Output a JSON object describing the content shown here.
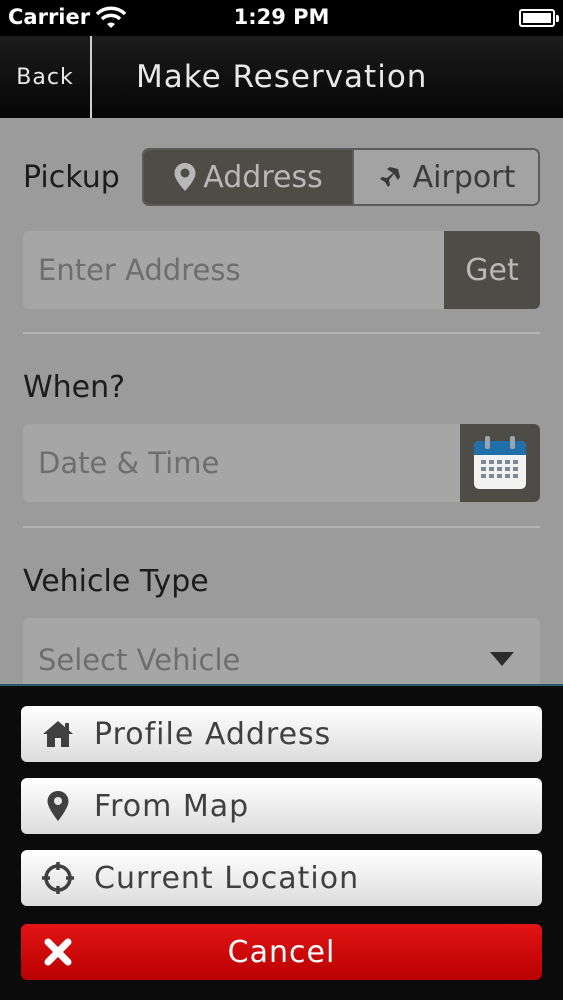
{
  "status_bar": {
    "carrier": "Carrier",
    "time": "1:29 PM"
  },
  "nav": {
    "back_label": "Back",
    "title": "Make Reservation"
  },
  "pickup": {
    "label": "Pickup",
    "segments": [
      {
        "label": "Address",
        "icon": "map-pin-icon",
        "selected": true
      },
      {
        "label": "Airport",
        "icon": "airplane-icon",
        "selected": false
      }
    ],
    "address_placeholder": "Enter Address",
    "get_label": "Get"
  },
  "when": {
    "label": "When?",
    "placeholder": "Date & Time",
    "icon": "calendar-icon"
  },
  "vehicle": {
    "label": "Vehicle Type",
    "placeholder": "Select Vehicle"
  },
  "action_sheet": {
    "options": [
      {
        "label": "Profile Address",
        "icon": "home-icon"
      },
      {
        "label": "From Map",
        "icon": "map-pin-icon"
      },
      {
        "label": "Current Location",
        "icon": "crosshair-icon"
      }
    ],
    "cancel_label": "Cancel"
  },
  "colors": {
    "cancel": "#d40000",
    "segment_active": "#4d4c47",
    "sheet_background": "#0b0b0b"
  }
}
